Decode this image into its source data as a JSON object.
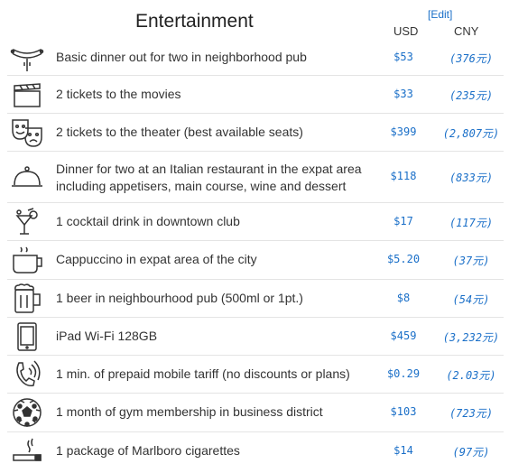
{
  "section": {
    "title": "Entertainment",
    "edit_label": "[Edit]",
    "col_usd": "USD",
    "col_cny": "CNY"
  },
  "rows": [
    {
      "icon": "sausage-fork-icon",
      "label": "Basic dinner out for two in neighborhood pub",
      "usd": "$53",
      "cny": "(376元)"
    },
    {
      "icon": "clapperboard-icon",
      "label": "2 tickets to the movies",
      "usd": "$33",
      "cny": "(235元)"
    },
    {
      "icon": "theater-masks-icon",
      "label": "2 tickets to the theater (best available seats)",
      "usd": "$399",
      "cny": "(2,807元)"
    },
    {
      "icon": "cloche-icon",
      "label": "Dinner for two at an Italian restaurant in the expat area including appetisers, main course, wine and dessert",
      "usd": "$118",
      "cny": "(833元)"
    },
    {
      "icon": "cocktail-icon",
      "label": "1 cocktail drink in downtown club",
      "usd": "$17",
      "cny": "(117元)"
    },
    {
      "icon": "coffee-cup-icon",
      "label": "Cappuccino in expat area of the city",
      "usd": "$5.20",
      "cny": "(37元)"
    },
    {
      "icon": "beer-mug-icon",
      "label": "1 beer in neighbourhood pub (500ml or 1pt.)",
      "usd": "$8",
      "cny": "(54元)"
    },
    {
      "icon": "tablet-icon",
      "label": "iPad Wi-Fi 128GB",
      "usd": "$459",
      "cny": "(3,232元)"
    },
    {
      "icon": "phone-handset-icon",
      "label": "1 min. of prepaid mobile tariff (no discounts or plans)",
      "usd": "$0.29",
      "cny": "(2.03元)"
    },
    {
      "icon": "soccer-ball-icon",
      "label": "1 month of gym membership in business district",
      "usd": "$103",
      "cny": "(723元)"
    },
    {
      "icon": "cigarette-icon",
      "label": "1 package of Marlboro cigarettes",
      "usd": "$14",
      "cny": "(97元)"
    }
  ]
}
